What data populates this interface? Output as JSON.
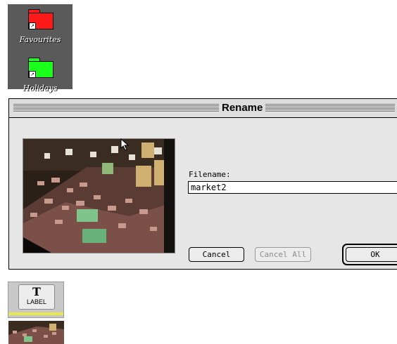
{
  "desktop": {
    "folders": [
      {
        "label": "Favourites",
        "color": "#ff1a1a",
        "icon": "folder-alias-icon"
      },
      {
        "label": "Holidays",
        "color": "#19ff19",
        "icon": "folder-alias-icon"
      }
    ]
  },
  "dialog": {
    "title": "Rename",
    "filename_label": "Filename:",
    "filename_value": "market2",
    "buttons": {
      "cancel": "Cancel",
      "cancel_all": "Cancel All",
      "ok": "OK"
    }
  },
  "toolbar": {
    "label_tool_glyph": "T",
    "label_tool_text": "LABEL"
  }
}
